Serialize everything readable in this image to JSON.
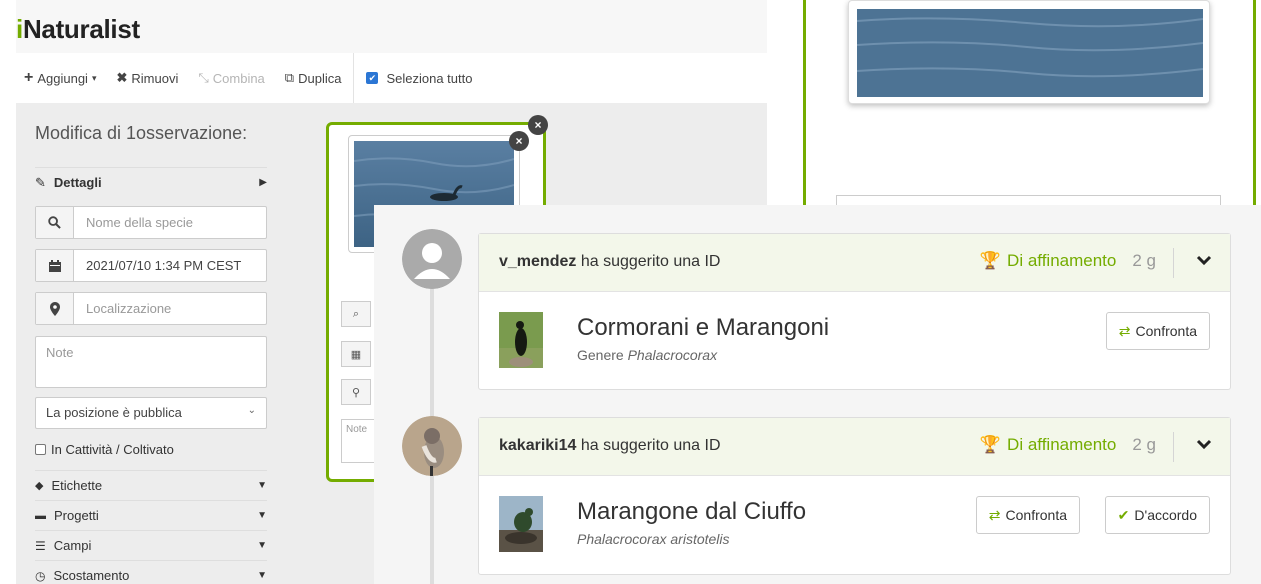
{
  "app": {
    "logo_i": "i",
    "logo_rest": "Naturalist"
  },
  "toolbar": {
    "add": "Aggiungi",
    "remove": "Rimuovi",
    "combine": "Combina",
    "duplicate": "Duplica",
    "select_all": "Seleziona tutto"
  },
  "sidebar": {
    "title": "Modifica di 1osservazione:",
    "details": "Dettagli",
    "species_placeholder": "Nome della specie",
    "date_value": "2021/07/10 1:34 PM CEST",
    "location_placeholder": "Localizzazione",
    "notes_placeholder": "Note",
    "privacy": "La posizione è pubblica",
    "captive": "In Cattività / Coltivato",
    "sections": [
      "Etichette",
      "Progetti",
      "Campi",
      "Scostamento"
    ]
  },
  "card": {
    "notes_placeholder": "Note"
  },
  "identifications": [
    {
      "user": "v_mendez",
      "suggested": "ha suggerito una ID",
      "category": "Di affinamento",
      "age": "2 g",
      "taxon_common": "Cormorani e Marangoni",
      "taxon_rank": "Genere",
      "taxon_sci": "Phalacrocorax",
      "compare": "Confronta"
    },
    {
      "user": "kakariki14",
      "suggested": "ha suggerito una ID",
      "category": "Di affinamento",
      "age": "2 g",
      "taxon_common": "Marangone dal Ciuffo",
      "taxon_sci": "Phalacrocorax aristotelis",
      "compare": "Confronta",
      "agree": "D'accordo"
    }
  ],
  "colors": {
    "accent": "#74ac00",
    "checkbox": "#2b76d4"
  }
}
